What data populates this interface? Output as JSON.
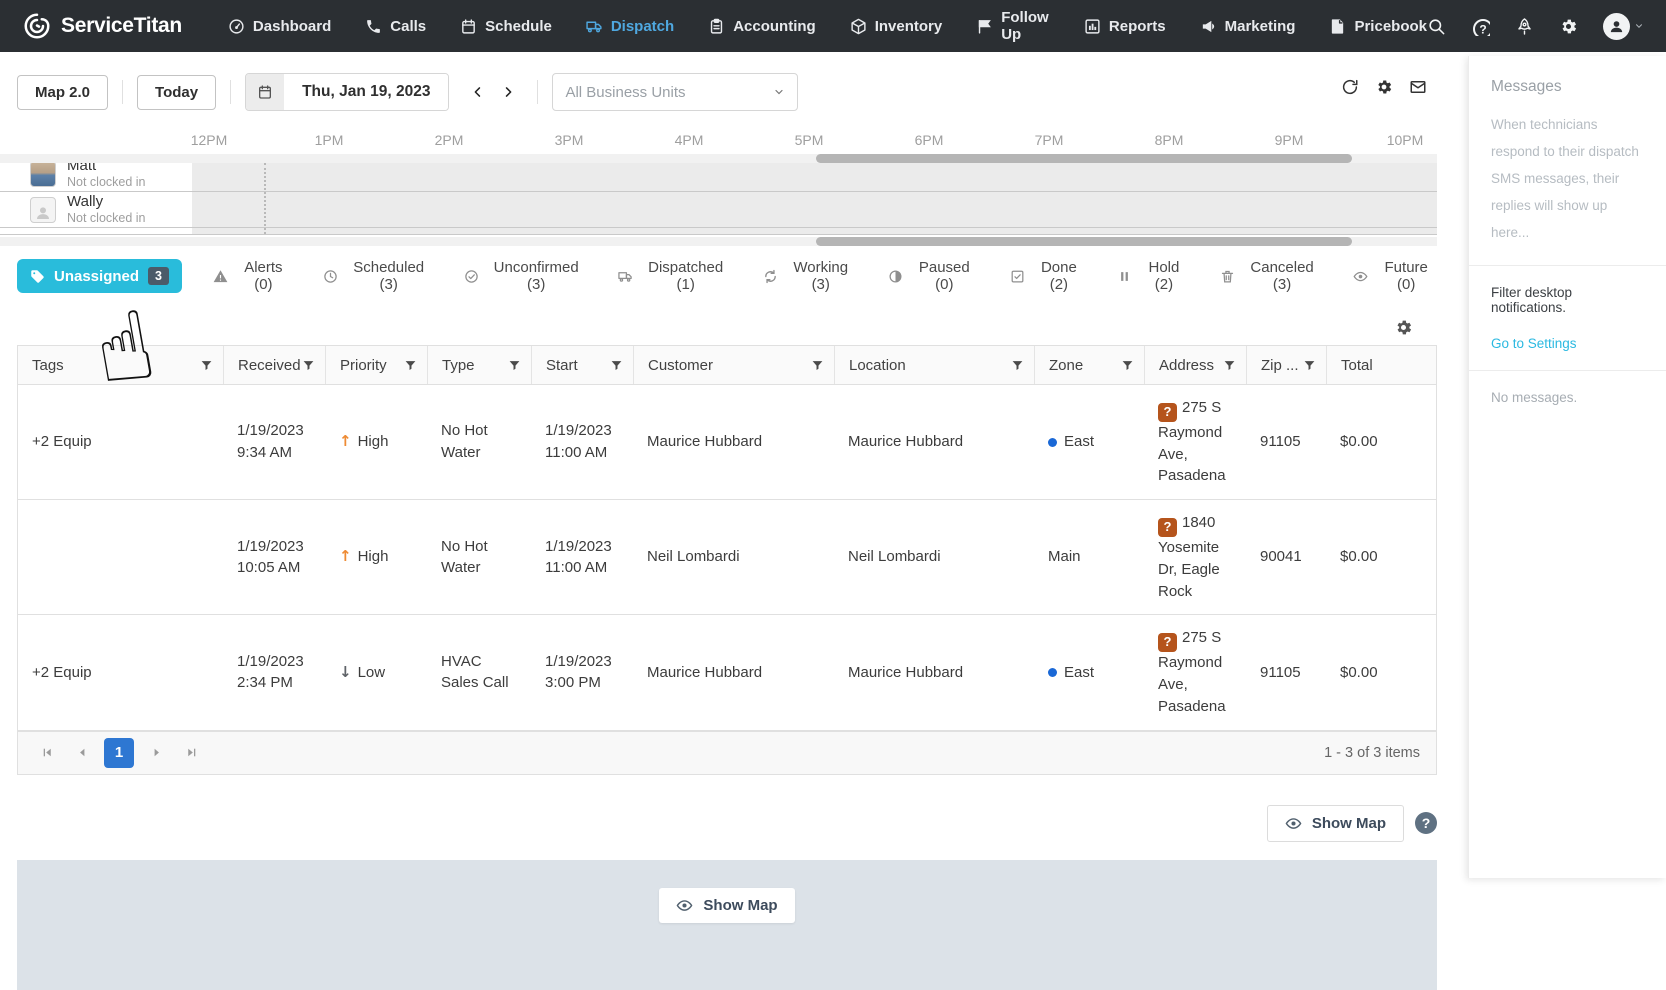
{
  "nav": {
    "brand": "ServiceTitan",
    "items": [
      {
        "label": "Dashboard",
        "icon": "gauge-icon",
        "active": false
      },
      {
        "label": "Calls",
        "icon": "phone-icon",
        "active": false
      },
      {
        "label": "Schedule",
        "icon": "calendar-icon",
        "active": false
      },
      {
        "label": "Dispatch",
        "icon": "truck-icon",
        "active": true
      },
      {
        "label": "Accounting",
        "icon": "clipboard-icon",
        "active": false
      },
      {
        "label": "Inventory",
        "icon": "cube-icon",
        "active": false
      },
      {
        "label": "Follow Up",
        "icon": "flag-icon",
        "active": false
      },
      {
        "label": "Reports",
        "icon": "bar-chart-icon",
        "active": false
      },
      {
        "label": "Marketing",
        "icon": "megaphone-icon",
        "active": false
      },
      {
        "label": "Pricebook",
        "icon": "book-icon",
        "active": false
      }
    ],
    "right_icons": [
      "search-icon",
      "help-icon",
      "rocket-icon",
      "gear-icon",
      "avatar-icon",
      "chevron-down-icon"
    ]
  },
  "toolbar": {
    "map_button": "Map 2.0",
    "today_button": "Today",
    "date": "Thu, Jan 19, 2023",
    "business_units_placeholder": "All Business Units",
    "right_icons": [
      "refresh-icon",
      "gear-icon",
      "mail-icon"
    ]
  },
  "timeline": {
    "hours": [
      "12PM",
      "1PM",
      "2PM",
      "3PM",
      "4PM",
      "5PM",
      "6PM",
      "7PM",
      "8PM",
      "9PM",
      "10PM"
    ]
  },
  "technicians": [
    {
      "name": "Matt",
      "status": "Not clocked in"
    },
    {
      "name": "Wally",
      "status": "Not clocked in"
    }
  ],
  "tabs": {
    "active": {
      "label": "Unassigned",
      "badge": "3",
      "icon": "tag-icon"
    },
    "items": [
      {
        "label": "Alerts (0)",
        "icon": "warning-icon"
      },
      {
        "label": "Scheduled (3)",
        "icon": "clock-icon"
      },
      {
        "label": "Unconfirmed (3)",
        "icon": "check-circle-icon"
      },
      {
        "label": "Dispatched (1)",
        "icon": "truck-icon"
      },
      {
        "label": "Working (3)",
        "icon": "sync-icon"
      },
      {
        "label": "Paused (0)",
        "icon": "half-circle-icon"
      },
      {
        "label": "Done (2)",
        "icon": "check-square-icon"
      },
      {
        "label": "Hold (2)",
        "icon": "pause-icon"
      },
      {
        "label": "Canceled (3)",
        "icon": "trash-icon"
      },
      {
        "label": "Future (0)",
        "icon": "eye-icon"
      }
    ]
  },
  "table": {
    "headers": [
      "Tags",
      "Received",
      "Priority",
      "Type",
      "Start",
      "Customer",
      "Location",
      "Zone",
      "Address",
      "Zip ...",
      "Total"
    ],
    "rows": [
      {
        "tags": "+2 Equip",
        "received_date": "1/19/2023",
        "received_time": "9:34 AM",
        "priority": "High",
        "priority_arrow": "↑",
        "priority_level": "high",
        "type": "No Hot Water",
        "start_date": "1/19/2023",
        "start_time": "11:00 AM",
        "customer": "Maurice Hubbard",
        "location": "Maurice Hubbard",
        "zone": "East",
        "zone_dot": "true",
        "address_badge": "?",
        "address": "275 S Raymond Ave, Pasadena",
        "zip": "91105",
        "total": "$0.00"
      },
      {
        "tags": "",
        "received_date": "1/19/2023",
        "received_time": "10:05 AM",
        "priority": "High",
        "priority_arrow": "↑",
        "priority_level": "high",
        "type": "No Hot Water",
        "start_date": "1/19/2023",
        "start_time": "11:00 AM",
        "customer": "Neil Lombardi",
        "location": "Neil Lombardi",
        "zone": "Main",
        "zone_dot": "false",
        "address_badge": "?",
        "address": "1840 Yosemite Dr, Eagle Rock",
        "zip": "90041",
        "total": "$0.00"
      },
      {
        "tags": "+2 Equip",
        "received_date": "1/19/2023",
        "received_time": "2:34 PM",
        "priority": "Low",
        "priority_arrow": "↓",
        "priority_level": "low",
        "type": "HVAC Sales Call",
        "start_date": "1/19/2023",
        "start_time": "3:00 PM",
        "customer": "Maurice Hubbard",
        "location": "Maurice Hubbard",
        "zone": "East",
        "zone_dot": "true",
        "address_badge": "?",
        "address": "275 S Raymond Ave, Pasadena",
        "zip": "91105",
        "total": "$0.00"
      }
    ]
  },
  "pagination": {
    "page": "1",
    "summary": "1 - 3 of 3 items"
  },
  "map": {
    "show_map_label": "Show Map"
  },
  "sidebar": {
    "title": "Messages",
    "description": "When technicians respond to their dispatch SMS messages, their replies will show up here...",
    "filter_note": "Filter desktop notifications.",
    "settings_link": "Go to Settings",
    "empty": "No messages."
  },
  "colors": {
    "nav_bg": "#2b2f33",
    "nav_active": "#4fa8e0",
    "unassigned_tab": "#29bcdb",
    "unassigned_badge": "#4b5b69",
    "priority_high": "#ee8b34",
    "priority_low": "#5f6368",
    "zone_dot": "#1a68d6",
    "address_badge": "#b5541c",
    "active_page": "#2e77d2",
    "settings_link": "#2bb9e1",
    "map_strip_bg": "#dce2e8"
  }
}
